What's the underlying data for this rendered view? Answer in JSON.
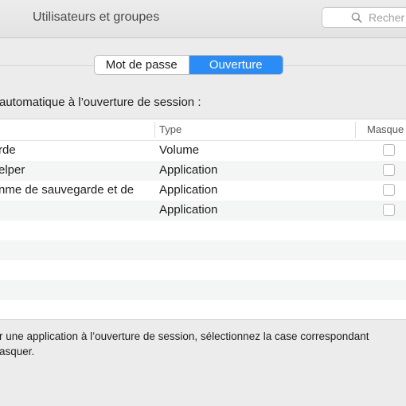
{
  "window": {
    "title": "Utilisateurs et groupes",
    "search_placeholder": "Recher"
  },
  "tabs": [
    {
      "label": "Mot de passe",
      "active": false
    },
    {
      "label": "Ouverture",
      "active": true
    }
  ],
  "section": {
    "label": "automatique à l’ouverture de session :"
  },
  "table": {
    "columns": [
      "Type",
      "Masque"
    ],
    "rows": [
      {
        "name": "rde",
        "type": "Volume",
        "hidden": false
      },
      {
        "name": "elper",
        "type": "Application",
        "hidden": false
      },
      {
        "name": "nme de sauvegarde et de",
        "type": "Application",
        "hidden": false
      },
      {
        "name": "",
        "type": "Application",
        "hidden": false
      }
    ]
  },
  "footer": {
    "line1": "r une application à l’ouverture de session, sélectionnez la case correspondant",
    "line2": "asquer."
  },
  "colors": {
    "accent": "#2a8cf6",
    "row_alt": "#f4f5f5",
    "window_bg": "#ececec"
  }
}
